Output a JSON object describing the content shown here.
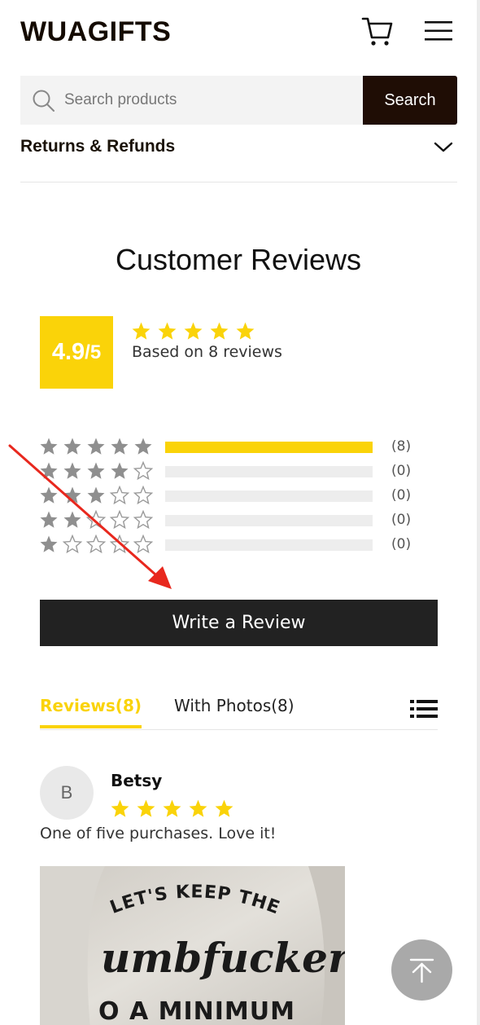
{
  "header": {
    "logo": "WUAGIFTS",
    "cart_icon": "cart-icon",
    "menu_icon": "hamburger-menu-icon"
  },
  "search": {
    "placeholder": "Search products",
    "button_label": "Search"
  },
  "accordion": {
    "title": "Returns & Refunds"
  },
  "reviews": {
    "title": "Customer Reviews",
    "score_main": "4.9",
    "score_suffix": "/5",
    "average_rating": 4.9,
    "summary_text": "Based on 8 reviews",
    "distribution": [
      {
        "stars": 5,
        "count_label": "(8)",
        "fraction": 1.0
      },
      {
        "stars": 4,
        "count_label": "(0)",
        "fraction": 0.0
      },
      {
        "stars": 3,
        "count_label": "(0)",
        "fraction": 0.0
      },
      {
        "stars": 2,
        "count_label": "(0)",
        "fraction": 0.0
      },
      {
        "stars": 1,
        "count_label": "(0)",
        "fraction": 0.0
      }
    ],
    "write_button": "Write a Review",
    "tabs": [
      {
        "label": "Reviews(8)",
        "active": true
      },
      {
        "label": "With Photos(8)",
        "active": false
      }
    ],
    "items": [
      {
        "initial": "B",
        "name": "Betsy",
        "rating": 5,
        "text": "One of five purchases. Love it!",
        "photo_text": [
          "LET'S KEEP THE",
          "umbfuckery",
          "O A MINIMUM"
        ]
      }
    ]
  },
  "colors": {
    "accent": "#fad309",
    "dark": "#1f0d05",
    "button": "#222222",
    "annotation": "#e8281e"
  }
}
